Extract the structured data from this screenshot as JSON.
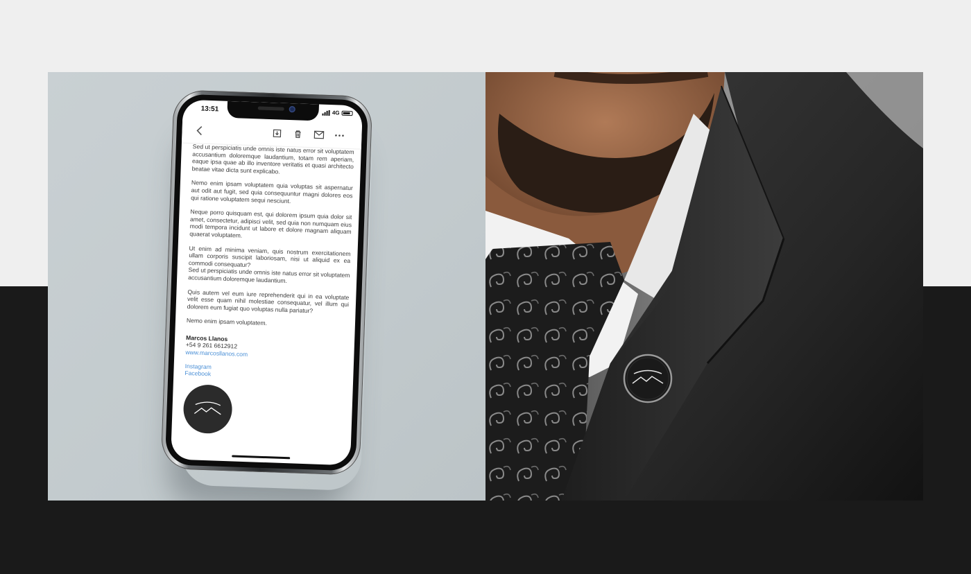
{
  "phone": {
    "status_time": "13:51",
    "network": "4G",
    "toolbar": {
      "back_icon": "chevron-left-icon",
      "archive_icon": "archive-icon",
      "trash_icon": "trash-icon",
      "mail_icon": "mail-icon",
      "more_icon": "more-icon"
    },
    "email": {
      "paragraphs": [
        "Sed ut perspiciatis unde omnis iste natus error sit voluptatem accusantium doloremque laudantium, totam rem aperiam, eaque ipsa quae ab illo inventore veritatis et quasi architecto beatae vitae dicta sunt explicabo.",
        "Nemo enim ipsam voluptatem quia voluptas sit aspernatur aut odit aut fugit, sed quia consequuntur magni dolores eos qui ratione voluptatem sequi nesciunt.",
        "Neque porro quisquam est, qui dolorem ipsum quia dolor sit amet, consectetur, adipisci velit, sed quia non numquam eius modi tempora incidunt ut labore et dolore magnam aliquam quaerat voluptatem.",
        "Ut enim ad minima veniam, quis nostrum exercitationem ullam corporis suscipit laboriosam, nisi ut aliquid ex ea commodi consequatur?",
        "Sed ut perspiciatis unde omnis iste natus error sit voluptatem accusantium doloremque laudantium.",
        "Quis autem vel eum iure reprehenderit qui in ea voluptate velit esse quam nihil molestiae consequatur, vel illum qui dolorem eum fugiat quo voluptas nulla pariatur?",
        "Nemo enim ipsam voluptatem."
      ],
      "signature": {
        "name": "Marcos Llanos",
        "phone": "+54 9 261 6612912",
        "website": "www.marcosllanos.com",
        "instagram": "Instagram",
        "facebook": "Facebook"
      }
    }
  },
  "colors": {
    "link": "#4a8fd6",
    "dark_band": "#1a1a1a",
    "light_band": "#efefef",
    "panel_bg": "#c6cdd0"
  }
}
